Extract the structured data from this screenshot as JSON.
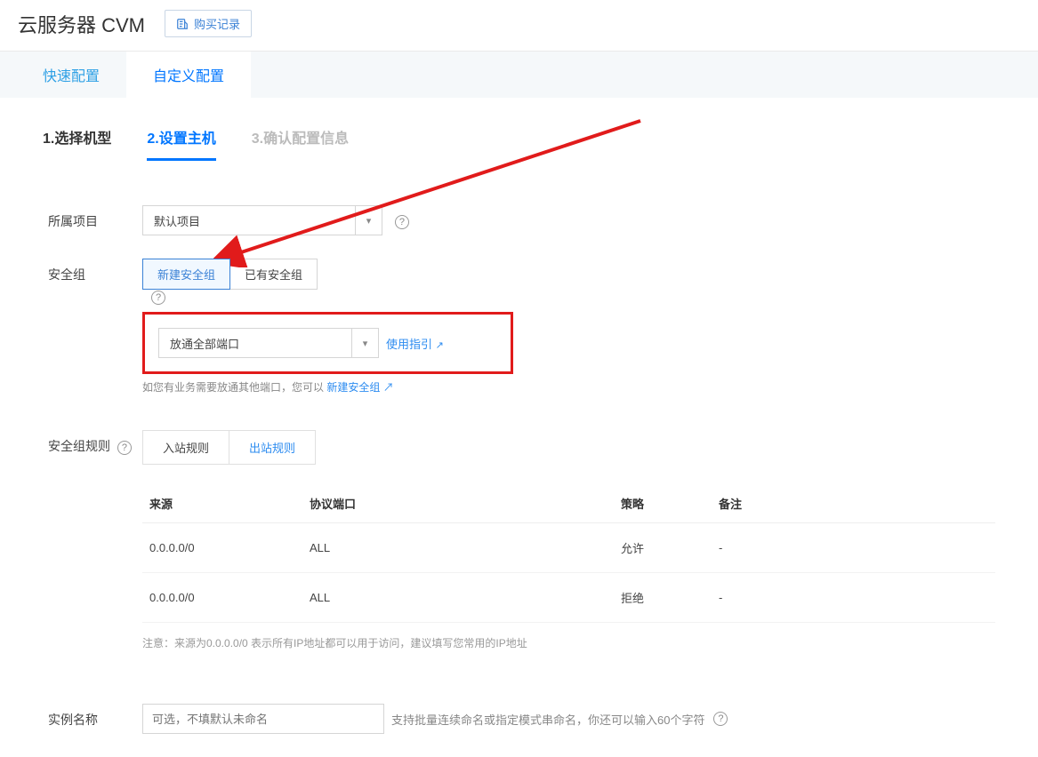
{
  "header": {
    "title": "云服务器 CVM",
    "historyBtn": "购买记录"
  },
  "mainTabs": {
    "quick": "快速配置",
    "custom": "自定义配置"
  },
  "steps": {
    "s1": "1.选择机型",
    "s2": "2.设置主机",
    "s3": "3.确认配置信息"
  },
  "project": {
    "label": "所属项目",
    "value": "默认项目"
  },
  "securityGroup": {
    "label": "安全组",
    "optNew": "新建安全组",
    "optExist": "已有安全组",
    "selectValue": "放通全部端口",
    "guideLink": "使用指引",
    "hintPrefix": "如您有业务需要放通其他端口，您可以 ",
    "hintLink": "新建安全组"
  },
  "rules": {
    "label": "安全组规则",
    "tabInbound": "入站规则",
    "tabOutbound": "出站规则",
    "columns": {
      "source": "来源",
      "protocol": "协议端口",
      "policy": "策略",
      "remark": "备注"
    },
    "rows": [
      {
        "source": "0.0.0.0/0",
        "protocol": "ALL",
        "policy": "允许",
        "remark": "-"
      },
      {
        "source": "0.0.0.0/0",
        "protocol": "ALL",
        "policy": "拒绝",
        "remark": "-"
      }
    ],
    "note": "注意：来源为0.0.0.0/0 表示所有IP地址都可以用于访问，建议填写您常用的IP地址"
  },
  "instanceName": {
    "label": "实例名称",
    "placeholder": "可选，不填默认未命名",
    "hint": "支持批量连续命名或指定模式串命名，你还可以输入60个字符"
  }
}
